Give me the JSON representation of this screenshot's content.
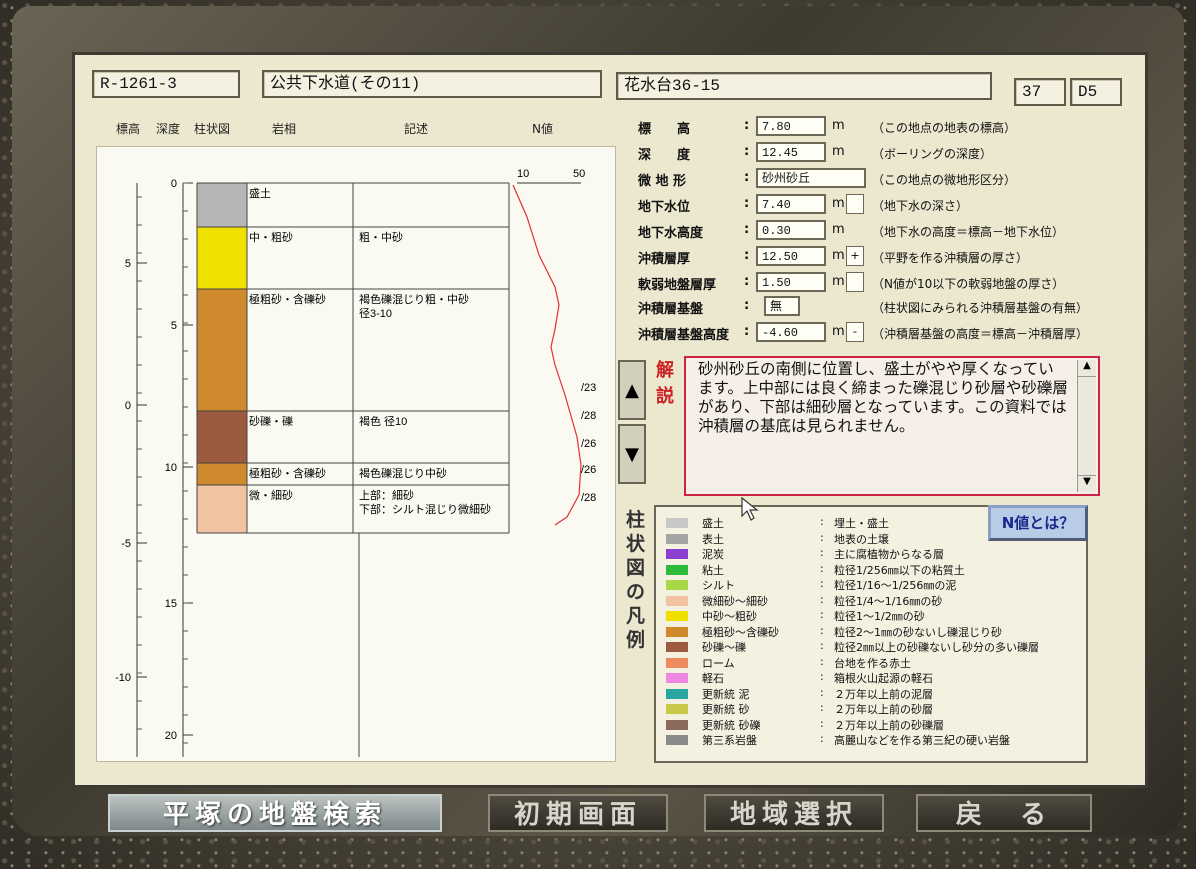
{
  "header": {
    "site_id": "R-1261-3",
    "project": "公共下水道(その11)",
    "location": "花水台36-15",
    "num1": "37",
    "num2": "D5"
  },
  "columns": {
    "elevation": "標高",
    "depth": "深度",
    "column": "柱状図",
    "rock": "岩相",
    "desc": "記述",
    "nvalue": "N値"
  },
  "nscale": {
    "t10": "10",
    "t50": "50"
  },
  "axis": {
    "elev_ticks": [
      "5",
      "0",
      "-5",
      "-10"
    ],
    "depth_ticks": [
      "0",
      "5",
      "10",
      "15",
      "20"
    ]
  },
  "layers": [
    {
      "rock": "盛土",
      "desc": "",
      "color": "#b6b6b6"
    },
    {
      "rock": "中・粗砂",
      "desc": "粗・中砂",
      "color": "#f0e000"
    },
    {
      "rock": "極粗砂・含礫砂",
      "desc": "褐色礫混じり粗・中砂\n径3-10",
      "color": "#cf8a2e"
    },
    {
      "rock": "砂礫・礫",
      "desc": "褐色 径10",
      "color": "#9c5a3f"
    },
    {
      "rock": "極粗砂・含礫砂",
      "desc": "褐色礫混じり中砂",
      "color": "#cf8a2e"
    },
    {
      "rock": "微・細砂",
      "desc": "上部：細砂\n下部：シルト混じり微細砂",
      "color": "#f2c3a0"
    }
  ],
  "nvalues": [
    "/23",
    "/28",
    "/26",
    "/26",
    "/28"
  ],
  "info": [
    {
      "label": "標　　高",
      "value": "7.80",
      "unit": "m",
      "chk": "",
      "note": "（この地点の地表の標高）"
    },
    {
      "label": "深　　度",
      "value": "12.45",
      "unit": "m",
      "chk": "",
      "note": "（ボーリングの深度）"
    },
    {
      "label": "微 地 形",
      "value": "砂州砂丘",
      "unit": "",
      "chk": "",
      "note": "（この地点の微地形区分）"
    },
    {
      "label": "地下水位",
      "value": "7.40",
      "unit": "m",
      "chk": " ",
      "note": "（地下水の深さ）"
    },
    {
      "label": "地下水高度",
      "value": "0.30",
      "unit": "m",
      "chk": "",
      "note": "（地下水の高度＝標高－地下水位）"
    },
    {
      "label": "沖積層厚",
      "value": "12.50",
      "unit": "m",
      "chk": "+",
      "note": "（平野を作る沖積層の厚さ）"
    },
    {
      "label": "軟弱地盤層厚",
      "value": "1.50",
      "unit": "m",
      "chk": " ",
      "note": "（N値が10以下の軟弱地盤の厚さ）"
    },
    {
      "label": "沖積層基盤",
      "value": "無",
      "unit": "",
      "chk": "",
      "note": "（柱状図にみられる沖積層基盤の有無）"
    },
    {
      "label": "沖積層基盤高度",
      "value": "-4.60",
      "unit": "m",
      "chk": "-",
      "note": "（沖積層基盤の高度＝標高－沖積層厚）"
    }
  ],
  "description": {
    "label_a": "解",
    "label_b": "説",
    "text": "砂州砂丘の南側に位置し、盛土がやや厚くなっています。上中部には良く締まった礫混じり砂層や砂礫層があり、下部は細砂層となっています。この資料では沖積層の基底は見られません。"
  },
  "legend": {
    "title": "柱状図の凡例",
    "nvalue_button": "N値とは？",
    "items": [
      {
        "name": "盛土",
        "desc": "埋土・盛土",
        "color": "#c8c8c8"
      },
      {
        "name": "表土",
        "desc": "地表の土壌",
        "color": "#a4a4a4"
      },
      {
        "name": "泥炭",
        "desc": "主に腐植物からなる層",
        "color": "#8a3fd0"
      },
      {
        "name": "粘土",
        "desc": "粒径1/256㎜以下の粘質土",
        "color": "#2dbb3a"
      },
      {
        "name": "シルト",
        "desc": "粒径1/16～1/256㎜の泥",
        "color": "#a8d848"
      },
      {
        "name": "微細砂～細砂",
        "desc": "粒径1/4～1/16㎜の砂",
        "color": "#f2c3a0"
      },
      {
        "name": "中砂～粗砂",
        "desc": "粒径1～1/2㎜の砂",
        "color": "#f0e000"
      },
      {
        "name": "極粗砂～含礫砂",
        "desc": "粒径2～1㎜の砂ないし礫混じり砂",
        "color": "#cf8a2e"
      },
      {
        "name": "砂礫～礫",
        "desc": "粒径2㎜以上の砂礫ないし砂分の多い礫層",
        "color": "#9c5a3f"
      },
      {
        "name": "ローム",
        "desc": "台地を作る赤土",
        "color": "#ef8a5e"
      },
      {
        "name": "軽石",
        "desc": "箱根火山起源の軽石",
        "color": "#ee88e0"
      },
      {
        "name": "更新統 泥",
        "desc": "２万年以上前の泥層",
        "color": "#2aa6a0"
      },
      {
        "name": "更新統 砂",
        "desc": "２万年以上前の砂層",
        "color": "#c8c84a"
      },
      {
        "name": "更新統 砂礫",
        "desc": "２万年以上前の砂礫層",
        "color": "#8a6a5a"
      },
      {
        "name": "第三系岩盤",
        "desc": "高麗山などを作る第三紀の硬い岩盤",
        "color": "#8a8a8a"
      }
    ]
  },
  "nav": {
    "search": "平塚の地盤検索",
    "initial": "初期画面",
    "region": "地域選択",
    "back": "戻　る"
  }
}
